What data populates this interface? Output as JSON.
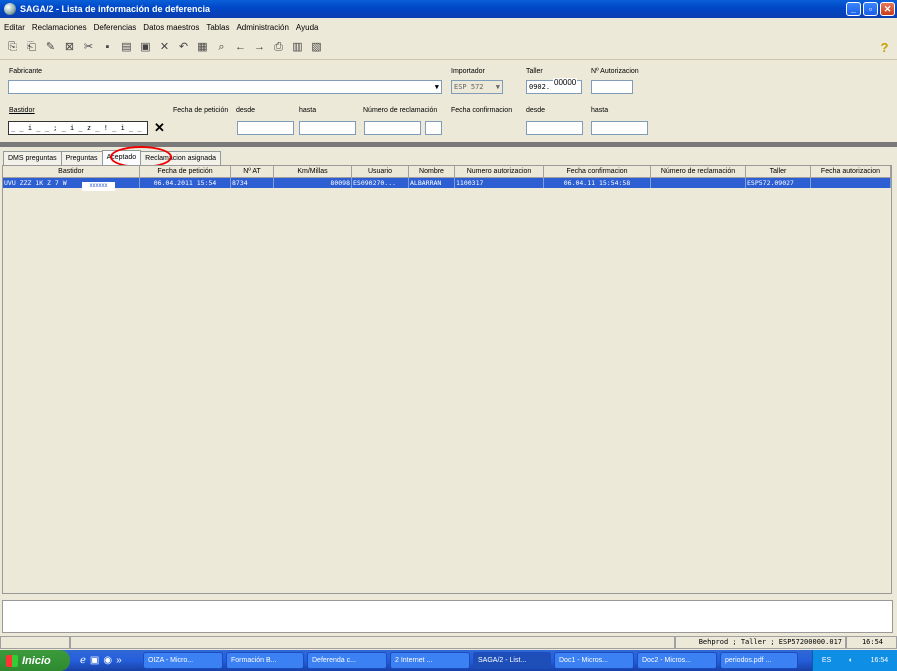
{
  "window": {
    "title": "SAGA/2 - Lista de información de deferencia"
  },
  "menu": [
    "Editar",
    "Reclamaciones",
    "Deferencias",
    "Datos maestros",
    "Tablas",
    "Administración",
    "Ayuda"
  ],
  "form": {
    "fabricante_label": "Fabricante",
    "fabricante_value": "",
    "importador_label": "Importador",
    "importador_value": "ESP 572",
    "taller_label": "Taller",
    "taller_value": "0902.",
    "taller_overlay": "00000",
    "autorizacion_label": "Nº Autorizacion",
    "autorizacion_value": "",
    "bastidor_label": "Bastidor",
    "bastidor_value": "_ _ i _ _ ; _ i _ z _ ! _ i _ _ ,",
    "fecha_peticion_label": "Fecha de petición",
    "desde_label": "desde",
    "hasta_label": "hasta",
    "num_reclamacion_label": "Número de reclamación",
    "fecha_confirmacion_label": "Fecha confirmacion",
    "desde2_label": "desde",
    "hasta2_label": "hasta"
  },
  "tabs": [
    "DMS preguntas",
    "Preguntas",
    "Aceptado",
    "Reclamacion asignada"
  ],
  "grid": {
    "columns": [
      "Bastidor",
      "Fecha de petición",
      "Nº AT",
      "Km/Millas",
      "Usuario",
      "Nombre",
      "Numero autorizacion",
      "Fecha confirmacion",
      "Número de reclamación",
      "Taller",
      "Fecha autorizacion"
    ],
    "rows": [
      [
        "UVU ZZZ 1K Z 7 W",
        "06.04.2011 15:54",
        "8734",
        "80098",
        "ES090270...",
        "ALBARRAN",
        "1100317",
        "06.04.11 15:54:58",
        "",
        "ESP572.09027",
        ""
      ]
    ],
    "mask_text": "xxxxxx"
  },
  "status": {
    "text": "Behprod ; Taller ; ESP57200000.017",
    "time": "16:54"
  },
  "taskbar": {
    "start": "Inicio",
    "tasks": [
      "OIZA - Micro...",
      "Formación B...",
      "Deferenda c...",
      "2 Internet ...",
      "SAGA/2 - List...",
      "Doc1 - Micros...",
      "Doc2 - Micros...",
      "periodos.pdf ..."
    ],
    "lang": "ES",
    "clock": "16:54"
  }
}
